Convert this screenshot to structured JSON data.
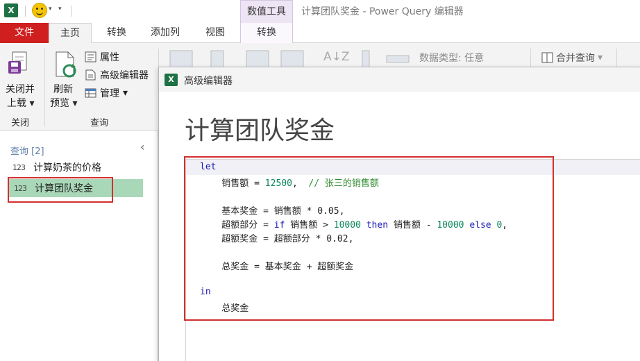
{
  "quick_access": {
    "app_icon": "excel-icon",
    "smiley_icon": "smiley-icon"
  },
  "window": {
    "context_tab_header": "数值工具",
    "title": "计算团队奖金 - Power Query 编辑器"
  },
  "ribbon_tabs": {
    "file": "文件",
    "home": "主页",
    "transform": "转换",
    "add_column": "添加列",
    "view": "视图",
    "context_transform": "转换"
  },
  "ribbon": {
    "close_load_line1": "关闭并",
    "close_load_line2": "上载",
    "close_group_label": "关闭",
    "refresh_line1": "刷新",
    "refresh_line2": "预览",
    "properties": "属性",
    "advanced_editor": "高级编辑器",
    "manage": "管理",
    "query_group_label": "查询",
    "data_type": "数据类型: 任意",
    "merge_queries": "合并查询"
  },
  "navigator": {
    "header": "查询 [2]",
    "items": [
      {
        "icon": "123",
        "label": "计算奶茶的价格"
      },
      {
        "icon": "123",
        "label": "计算团队奖金"
      }
    ]
  },
  "dialog": {
    "title": "高级编辑器",
    "heading": "计算团队奖金"
  },
  "colors": {
    "file_tab": "#cf1f1f",
    "excel_green": "#1e7145",
    "selected_query": "#a9d8b8",
    "annotation_red": "#d32f2f",
    "keyword": "#1b1bb4",
    "number": "#098658",
    "comment": "#2e8b2e"
  }
}
